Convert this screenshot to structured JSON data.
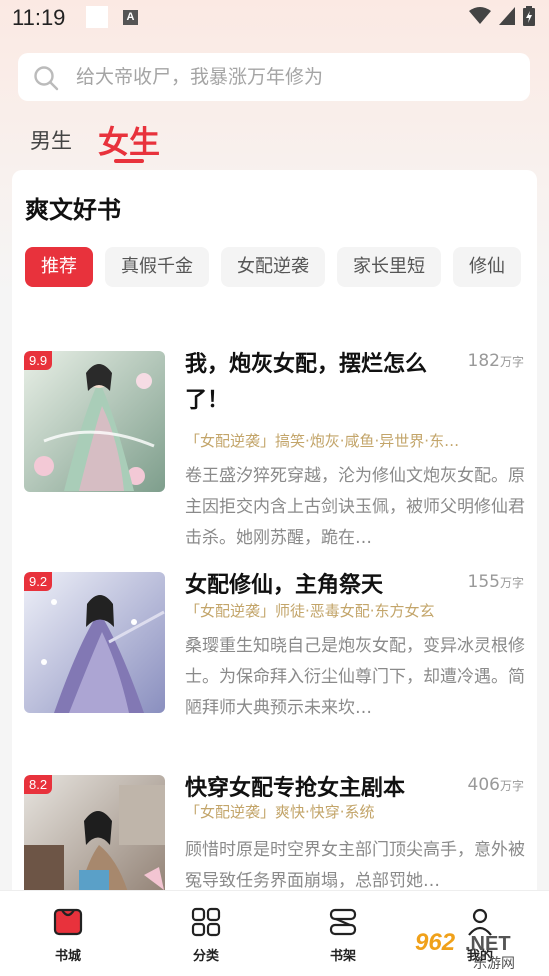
{
  "status_bar": {
    "time": "11:19",
    "icon": "A"
  },
  "search": {
    "placeholder": "给大帝收尸，我暴涨万年修为"
  },
  "gender_tabs": [
    {
      "label": "男生"
    },
    {
      "label": "女生"
    }
  ],
  "section": {
    "title": "爽文好书",
    "chips": [
      "推荐",
      "真假千金",
      "女配逆袭",
      "家长里短",
      "修仙"
    ]
  },
  "books": [
    {
      "score": "9.9",
      "title": "我，炮灰女配，摆烂怎么了！",
      "words": "182",
      "unit": "万字",
      "tags": "「女配逆袭」搞笑·炮灰·咸鱼·异世界·东…",
      "desc": "卷王盛汐猝死穿越，沦为修仙文炮灰女配。原主因拒交内含上古剑诀玉佩，被师父明修仙君击杀。她刚苏醒，跪在…",
      "colors": [
        "#cfe2d6",
        "#8fb3a3",
        "#f1d6df"
      ]
    },
    {
      "score": "9.2",
      "title": "女配修仙，主角祭天",
      "words": "155",
      "unit": "万字",
      "tags": "「女配逆袭」师徒·恶毒女配·东方女玄",
      "desc": "桑璎重生知晓自己是炮灰女配，变异冰灵根修士。为保命拜入衍尘仙尊门下，却遭冷遇。简陋拜师大典预示未来坎…",
      "colors": [
        "#dcdff0",
        "#9ea4cc",
        "#6f6aa3"
      ]
    },
    {
      "score": "8.2",
      "title": "快穿女配专抢女主剧本",
      "words": "406",
      "unit": "万字",
      "tags": "「女配逆袭」爽快·快穿·系统",
      "desc": "顾惜时原是时空界女主部门顶尖高手，意外被冤导致任务界面崩塌，总部罚她…",
      "colors": [
        "#d9d6d2",
        "#9e8a78",
        "#5b4a3f"
      ]
    }
  ],
  "bottom_nav": [
    {
      "label": "书城",
      "icon": "bookstore-icon",
      "active": true
    },
    {
      "label": "分类",
      "icon": "category-icon",
      "active": false
    },
    {
      "label": "书架",
      "icon": "bookshelf-icon",
      "active": false
    },
    {
      "label": "我的",
      "icon": "profile-icon",
      "active": false
    }
  ],
  "watermark": {
    "number": "962",
    "suffix": ".NET",
    "sub": "乐游网"
  },
  "colors": {
    "accent": "#e8323c",
    "tag": "#c3a56a",
    "muted": "#8a8a8a"
  }
}
